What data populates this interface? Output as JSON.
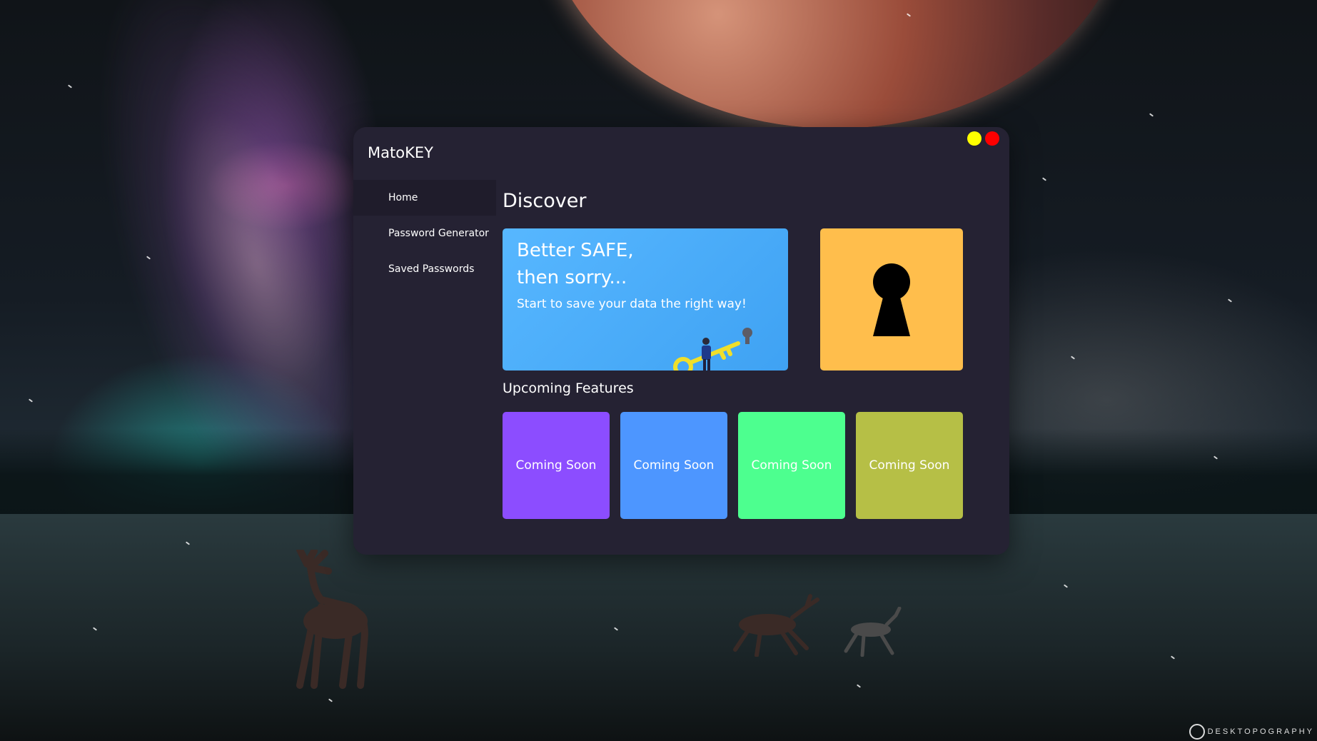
{
  "app": {
    "title": "MatoKEY",
    "controls": {
      "minimize_color": "#ffff00",
      "close_color": "#ff0000"
    }
  },
  "sidebar": {
    "items": [
      {
        "label": "Home",
        "active": true
      },
      {
        "label": "Password Generator",
        "active": false
      },
      {
        "label": "Saved Passwords",
        "active": false
      }
    ]
  },
  "main": {
    "title": "Discover",
    "hero": {
      "title_line1": "Better SAFE,",
      "title_line2": "then sorry...",
      "subtitle": "Start to save your data the right way!",
      "illustration_icon": "person-with-key-icon",
      "color": "#4db0fb"
    },
    "lock_card": {
      "icon": "keyhole-icon",
      "color": "#ffbe4c"
    },
    "upcoming_title": "Upcoming Features",
    "features": [
      {
        "label": "Coming Soon",
        "color": "#8c4dff"
      },
      {
        "label": "Coming Soon",
        "color": "#4d96ff"
      },
      {
        "label": "Coming Soon",
        "color": "#4dff8f"
      },
      {
        "label": "Coming Soon",
        "color": "#b6bf46"
      }
    ]
  },
  "desktop": {
    "watermark": "DESKTOPOGRAPHY"
  }
}
